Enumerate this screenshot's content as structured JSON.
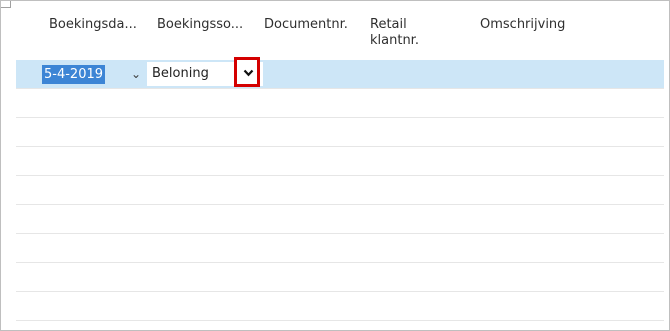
{
  "columns": [
    "Boekingsda...",
    "Boekingsso...",
    "Documentnr.",
    "Retail klantnr.",
    "Omschrijving"
  ],
  "row": {
    "date": "5-4-2019",
    "type": "Beloning"
  },
  "icons": {
    "date_picker": "chevron-down-icon",
    "type_dropdown": "chevron-down-icon"
  },
  "colors": {
    "active_row": "#cde6f7",
    "selection": "#3d85d5",
    "highlight_box": "#d40000"
  }
}
